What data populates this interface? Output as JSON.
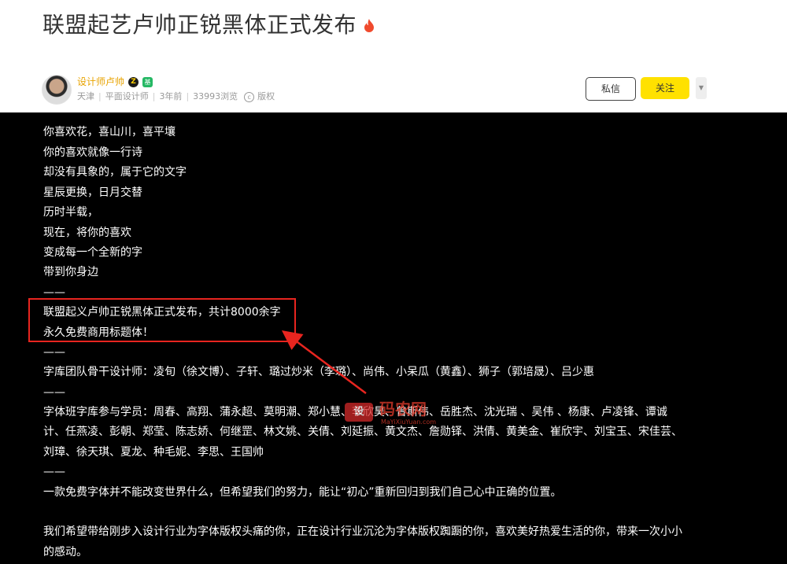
{
  "header": {
    "title": "联盟起艺卢帅正锐黑体正式发布",
    "title_icon": "fire-icon",
    "author": {
      "name": "设计师卢帅",
      "badge_z": "Z",
      "badge_tag": "基"
    },
    "meta": {
      "location": "天津",
      "field": "平面设计师",
      "time": "3年前",
      "views": "33993浏览",
      "copyright": "版权"
    },
    "buttons": {
      "message": "私信",
      "follow": "关注",
      "more": "▼"
    }
  },
  "article": {
    "lines": [
      "你喜欢花，喜山川，喜平壤",
      "你的喜欢就像一行诗",
      "却没有具象的，属于它的文字",
      "星辰更换，日月交替",
      "历时半载，",
      "现在，将你的喜欢",
      "变成每一个全新的字",
      "带到你身边",
      "——",
      "联盟起义卢帅正锐黑体正式发布，共计8000余字",
      "永久免费商用标题体！",
      "——",
      "字库团队骨干设计师：凌旬（徐文博）、子轩、璐过炒米（李璐）、尚伟、小呆瓜（黄鑫）、狮子（郭培晟）、吕少惠",
      "——",
      "字体班字库参与学员：周春、高翔、蒲永超、莫明潮、郑小慧、李欣昊、曾斯伟、岳胜杰、沈光瑞 、吴伟 、杨康、卢凌锋、谭诚",
      "计、任燕凌、彭朝、郑莹、陈志娇、何继罡、林文姚、关倩、刘延振、黄文杰、詹勋铎、洪倩、黄美金、崔欣宇、刘宝玉、宋佳芸、",
      "刘璋、徐天琪、夏龙、种毛妮、李思、王国帅",
      "——",
      "一款免费字体并不能改变世界什么，但希望我们的努力，能让“初心”重新回归到我们自己心中正确的位置。",
      "我们希望带给刚步入设计行业为字体版权头痛的你，正在设计行业沉沦为字体版权踟蹰的你，喜欢美好热爱生活的你，带来一次小小",
      "的感动。"
    ]
  },
  "watermark": {
    "badge": "设",
    "name": "码农网",
    "url": "MaYiXiuYuan.com"
  },
  "colors": {
    "accent_yellow": "#ffe100",
    "author_orange": "#e8a300",
    "highlight_red": "#e8251f",
    "content_bg": "#000000"
  }
}
